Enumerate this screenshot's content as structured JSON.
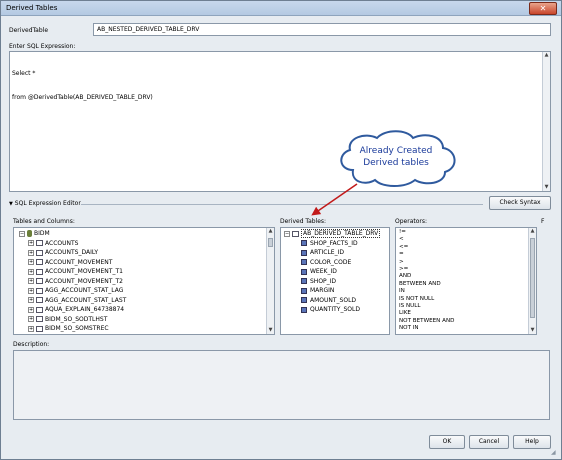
{
  "window": {
    "title": "Derived Tables",
    "close_glyph": "✕"
  },
  "derived_table": {
    "label": "DerivedTable",
    "value": "AB_NESTED_DERIVED_TABLE_DRV"
  },
  "sql": {
    "label": "Enter SQL Expression:",
    "lines": [
      "Select *",
      "from @DerivedTable(AB_DERIVED_TABLE_DRV)"
    ]
  },
  "editor": {
    "toggle_label": "SQL Expression Editor",
    "check_syntax_label": "Check Syntax"
  },
  "tables_columns": {
    "label": "Tables and Columns:",
    "root": "BIDM",
    "items": [
      "ACCOUNTS",
      "ACCOUNTS_DAILY",
      "ACCOUNT_MOVEMENT",
      "ACCOUNT_MOVEMENT_T1",
      "ACCOUNT_MOVEMENT_T2",
      "AGG_ACCOUNT_STAT_LAG",
      "AGG_ACCOUNT_STAT_LAST",
      "AQUA_EXPLAIN_64738874",
      "BIDM_SO_SODTLHST",
      "BIDM_SO_SOMSTREC"
    ]
  },
  "derived_tables": {
    "label": "Derived Tables:",
    "root": "AB_DERIVED_TABLE_DRV",
    "columns": [
      "SHOP_FACTS_ID",
      "ARTICLE_ID",
      "COLOR_CODE",
      "WEEK_ID",
      "SHOP_ID",
      "MARGIN",
      "AMOUNT_SOLD",
      "QUANTITY_SOLD"
    ]
  },
  "operators": {
    "label": "Operators:",
    "items": [
      "!=",
      "<",
      "<=",
      "=",
      ">",
      ">=",
      "AND",
      "BETWEEN  AND",
      "IN",
      "IS NOT NULL",
      "IS NULL",
      "LIKE",
      "NOT BETWEEN  AND",
      "NOT IN"
    ]
  },
  "functions_label": "F",
  "description": {
    "label": "Description:"
  },
  "buttons": {
    "ok": "OK",
    "cancel": "Cancel",
    "help": "Help"
  },
  "annotation": {
    "text_line1": "Already Created",
    "text_line2": "Derived tables",
    "color": "#1a3a9a"
  }
}
